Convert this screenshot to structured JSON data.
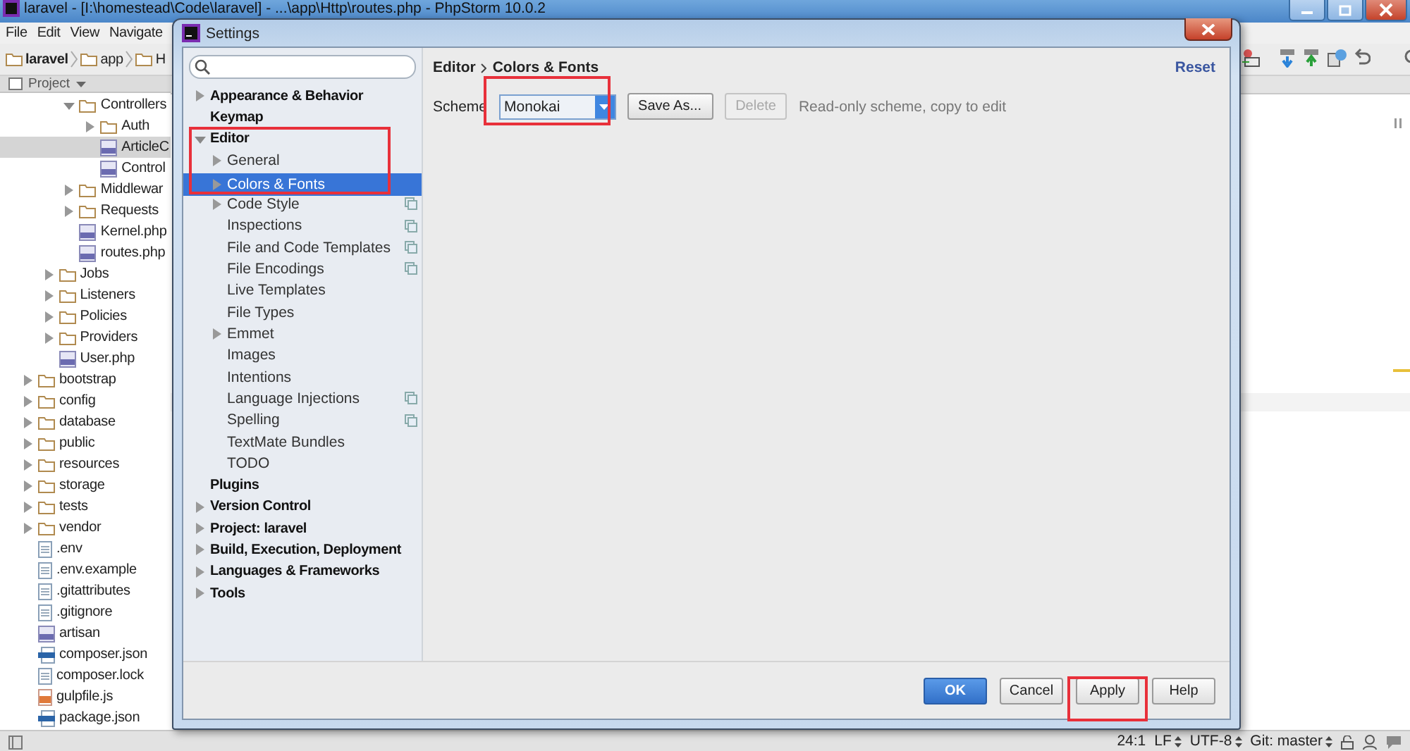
{
  "ide": {
    "title": "laravel - [I:\\homestead\\Code\\laravel] - ...\\app\\Http\\routes.php - PhpStorm 10.0.2",
    "menu": [
      "File",
      "Edit",
      "View",
      "Navigate"
    ],
    "breadcrumb": [
      "laravel",
      "app",
      "H"
    ],
    "tool_window": {
      "title": "Project"
    },
    "project_tree": [
      {
        "children": [
          {
            "children": [
              {
                "label": "Controllers",
                "kind": "folder",
                "expanded": true,
                "selected": false,
                "children": [
                  {
                    "label": "Auth",
                    "kind": "folder",
                    "expanded": false,
                    "selected": false
                  },
                  {
                    "label": "ArticleC",
                    "kind": "php",
                    "expanded": false,
                    "selected": true
                  },
                  {
                    "label": "Control",
                    "kind": "php",
                    "expanded": false,
                    "selected": false
                  }
                ]
              },
              {
                "label": "Middlewar",
                "kind": "folder",
                "expanded": false,
                "selected": false
              },
              {
                "label": "Requests",
                "kind": "folder",
                "expanded": false,
                "selected": false
              },
              {
                "label": "Kernel.php",
                "kind": "php",
                "expanded": false,
                "selected": false
              },
              {
                "label": "routes.php",
                "kind": "php",
                "expanded": false,
                "selected": false
              }
            ]
          },
          {
            "label": "Jobs",
            "kind": "folder",
            "expanded": false,
            "selected": false
          },
          {
            "label": "Listeners",
            "kind": "folder",
            "expanded": false,
            "selected": false
          },
          {
            "label": "Policies",
            "kind": "folder",
            "expanded": false,
            "selected": false
          },
          {
            "label": "Providers",
            "kind": "folder",
            "expanded": false,
            "selected": false
          },
          {
            "label": "User.php",
            "kind": "php",
            "expanded": false,
            "selected": false
          }
        ]
      },
      {
        "label": "bootstrap",
        "kind": "folder",
        "expanded": false,
        "selected": false
      },
      {
        "label": "config",
        "kind": "folder",
        "expanded": false,
        "selected": false
      },
      {
        "label": "database",
        "kind": "folder",
        "expanded": false,
        "selected": false
      },
      {
        "label": "public",
        "kind": "folder",
        "expanded": false,
        "selected": false
      },
      {
        "label": "resources",
        "kind": "folder",
        "expanded": false,
        "selected": false
      },
      {
        "label": "storage",
        "kind": "folder",
        "expanded": false,
        "selected": false
      },
      {
        "label": "tests",
        "kind": "folder",
        "expanded": false,
        "selected": false
      },
      {
        "label": "vendor",
        "kind": "folder",
        "expanded": false,
        "selected": false
      },
      {
        "label": ".env",
        "kind": "text",
        "expanded": false,
        "selected": false
      },
      {
        "label": ".env.example",
        "kind": "text",
        "expanded": false,
        "selected": false
      },
      {
        "label": ".gitattributes",
        "kind": "text",
        "expanded": false,
        "selected": false
      },
      {
        "label": ".gitignore",
        "kind": "text",
        "expanded": false,
        "selected": false
      },
      {
        "label": "artisan",
        "kind": "php",
        "expanded": false,
        "selected": false
      },
      {
        "label": "composer.json",
        "kind": "json",
        "expanded": false,
        "selected": false
      },
      {
        "label": "composer.lock",
        "kind": "text",
        "expanded": false,
        "selected": false
      },
      {
        "label": "gulpfile.js",
        "kind": "js",
        "expanded": false,
        "selected": false
      },
      {
        "label": "package.json",
        "kind": "json",
        "expanded": false,
        "selected": false
      }
    ],
    "status_bar": {
      "position": "24:1",
      "line_separator": "LF",
      "encoding": "UTF-8",
      "vcs": "Git: master"
    }
  },
  "settings": {
    "title": "Settings",
    "tree": [
      {
        "label": "Appearance & Behavior",
        "expandable": true,
        "expanded": false,
        "copy": false,
        "selected": false
      },
      {
        "label": "Keymap",
        "expandable": false,
        "expanded": false,
        "copy": false,
        "selected": false
      },
      {
        "label": "Editor",
        "expandable": true,
        "expanded": true,
        "copy": false,
        "selected": false,
        "children": [
          {
            "label": "General",
            "expandable": true,
            "expanded": false,
            "copy": false,
            "selected": false
          },
          {
            "label": "Colors & Fonts",
            "expandable": true,
            "expanded": false,
            "copy": false,
            "selected": true
          },
          {
            "label": "Code Style",
            "expandable": true,
            "expanded": false,
            "copy": true,
            "selected": false
          },
          {
            "label": "Inspections",
            "expandable": false,
            "expanded": false,
            "copy": true,
            "selected": false
          },
          {
            "label": "File and Code Templates",
            "expandable": false,
            "expanded": false,
            "copy": true,
            "selected": false
          },
          {
            "label": "File Encodings",
            "expandable": false,
            "expanded": false,
            "copy": true,
            "selected": false
          },
          {
            "label": "Live Templates",
            "expandable": false,
            "expanded": false,
            "copy": false,
            "selected": false
          },
          {
            "label": "File Types",
            "expandable": false,
            "expanded": false,
            "copy": false,
            "selected": false
          },
          {
            "label": "Emmet",
            "expandable": true,
            "expanded": false,
            "copy": false,
            "selected": false
          },
          {
            "label": "Images",
            "expandable": false,
            "expanded": false,
            "copy": false,
            "selected": false
          },
          {
            "label": "Intentions",
            "expandable": false,
            "expanded": false,
            "copy": false,
            "selected": false
          },
          {
            "label": "Language Injections",
            "expandable": false,
            "expanded": false,
            "copy": true,
            "selected": false
          },
          {
            "label": "Spelling",
            "expandable": false,
            "expanded": false,
            "copy": true,
            "selected": false
          },
          {
            "label": "TextMate Bundles",
            "expandable": false,
            "expanded": false,
            "copy": false,
            "selected": false
          },
          {
            "label": "TODO",
            "expandable": false,
            "expanded": false,
            "copy": false,
            "selected": false
          }
        ]
      },
      {
        "label": "Plugins",
        "expandable": false,
        "expanded": false,
        "copy": false,
        "selected": false
      },
      {
        "label": "Version Control",
        "expandable": true,
        "expanded": false,
        "copy": false,
        "selected": false
      },
      {
        "label": "Project: laravel",
        "expandable": true,
        "expanded": false,
        "copy": false,
        "selected": false
      },
      {
        "label": "Build, Execution, Deployment",
        "expandable": true,
        "expanded": false,
        "copy": false,
        "selected": false
      },
      {
        "label": "Languages & Frameworks",
        "expandable": true,
        "expanded": false,
        "copy": false,
        "selected": false
      },
      {
        "label": "Tools",
        "expandable": true,
        "expanded": false,
        "copy": false,
        "selected": false
      }
    ],
    "breadcrumb": [
      "Editor",
      "Colors & Fonts"
    ],
    "reset": "Reset",
    "scheme": {
      "label": "Scheme",
      "value": "Monokai"
    },
    "scheme_buttons": [
      {
        "label": "Save As...",
        "disabled": false
      },
      {
        "label": "Delete",
        "disabled": true
      }
    ],
    "note": "Read-only scheme, copy to edit",
    "footer_buttons": [
      {
        "label": "OK",
        "default": true
      },
      {
        "label": "Cancel",
        "default": false
      },
      {
        "label": "Apply",
        "default": false
      },
      {
        "label": "Help",
        "default": false
      }
    ]
  }
}
